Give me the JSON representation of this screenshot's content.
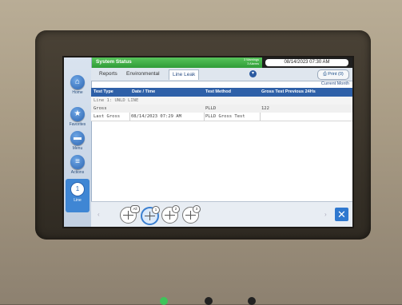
{
  "status": {
    "title": "System Status",
    "warnings_line1": "3 Warnings",
    "warnings_line2": "3 Alarms",
    "datetime": "08/14/2023 07:30 AM"
  },
  "nav": {
    "home": "Home",
    "favorites": "Favorites",
    "menu": "Menu",
    "actions": "Actions",
    "line_number": "1",
    "line": "Line"
  },
  "tabs": {
    "reports": "Reports",
    "environmental": "Environmental",
    "line_leak": "Line Leak",
    "print": "Print (0)"
  },
  "current_month": "Current Month",
  "table": {
    "headers": [
      "Test Type",
      "Date / Time",
      "Test Method",
      "Gross Test Previous 24Hs"
    ],
    "section": "Line 1: UNLD LINE",
    "rows": [
      [
        "Gross",
        "",
        "PLLD",
        "122"
      ],
      [
        "Last Gross",
        "08/14/2023 07:29 AM",
        "PLLD Gross Test",
        ""
      ]
    ]
  },
  "gauges": [
    "All",
    "1",
    "2",
    "3"
  ],
  "colors": {
    "status_green": "#3fae46",
    "header_blue": "#2e60a8",
    "accent_blue": "#2f78cf"
  }
}
